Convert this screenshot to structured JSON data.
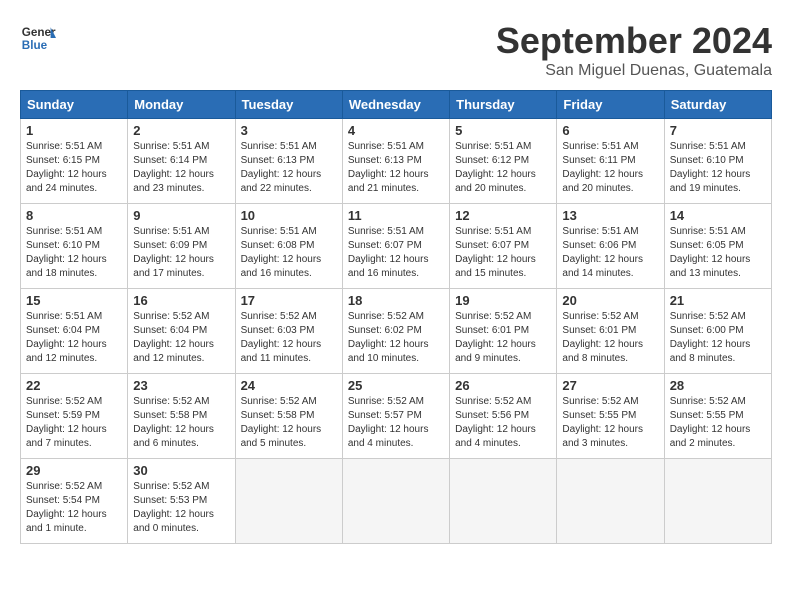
{
  "header": {
    "logo_line1": "General",
    "logo_line2": "Blue",
    "month": "September 2024",
    "location": "San Miguel Duenas, Guatemala"
  },
  "days_of_week": [
    "Sunday",
    "Monday",
    "Tuesday",
    "Wednesday",
    "Thursday",
    "Friday",
    "Saturday"
  ],
  "weeks": [
    [
      {
        "day": 1,
        "sunrise": "5:51 AM",
        "sunset": "6:15 PM",
        "daylight": "12 hours and 24 minutes."
      },
      {
        "day": 2,
        "sunrise": "5:51 AM",
        "sunset": "6:14 PM",
        "daylight": "12 hours and 23 minutes."
      },
      {
        "day": 3,
        "sunrise": "5:51 AM",
        "sunset": "6:13 PM",
        "daylight": "12 hours and 22 minutes."
      },
      {
        "day": 4,
        "sunrise": "5:51 AM",
        "sunset": "6:13 PM",
        "daylight": "12 hours and 21 minutes."
      },
      {
        "day": 5,
        "sunrise": "5:51 AM",
        "sunset": "6:12 PM",
        "daylight": "12 hours and 20 minutes."
      },
      {
        "day": 6,
        "sunrise": "5:51 AM",
        "sunset": "6:11 PM",
        "daylight": "12 hours and 20 minutes."
      },
      {
        "day": 7,
        "sunrise": "5:51 AM",
        "sunset": "6:10 PM",
        "daylight": "12 hours and 19 minutes."
      }
    ],
    [
      {
        "day": 8,
        "sunrise": "5:51 AM",
        "sunset": "6:10 PM",
        "daylight": "12 hours and 18 minutes."
      },
      {
        "day": 9,
        "sunrise": "5:51 AM",
        "sunset": "6:09 PM",
        "daylight": "12 hours and 17 minutes."
      },
      {
        "day": 10,
        "sunrise": "5:51 AM",
        "sunset": "6:08 PM",
        "daylight": "12 hours and 16 minutes."
      },
      {
        "day": 11,
        "sunrise": "5:51 AM",
        "sunset": "6:07 PM",
        "daylight": "12 hours and 16 minutes."
      },
      {
        "day": 12,
        "sunrise": "5:51 AM",
        "sunset": "6:07 PM",
        "daylight": "12 hours and 15 minutes."
      },
      {
        "day": 13,
        "sunrise": "5:51 AM",
        "sunset": "6:06 PM",
        "daylight": "12 hours and 14 minutes."
      },
      {
        "day": 14,
        "sunrise": "5:51 AM",
        "sunset": "6:05 PM",
        "daylight": "12 hours and 13 minutes."
      }
    ],
    [
      {
        "day": 15,
        "sunrise": "5:51 AM",
        "sunset": "6:04 PM",
        "daylight": "12 hours and 12 minutes."
      },
      {
        "day": 16,
        "sunrise": "5:52 AM",
        "sunset": "6:04 PM",
        "daylight": "12 hours and 12 minutes."
      },
      {
        "day": 17,
        "sunrise": "5:52 AM",
        "sunset": "6:03 PM",
        "daylight": "12 hours and 11 minutes."
      },
      {
        "day": 18,
        "sunrise": "5:52 AM",
        "sunset": "6:02 PM",
        "daylight": "12 hours and 10 minutes."
      },
      {
        "day": 19,
        "sunrise": "5:52 AM",
        "sunset": "6:01 PM",
        "daylight": "12 hours and 9 minutes."
      },
      {
        "day": 20,
        "sunrise": "5:52 AM",
        "sunset": "6:01 PM",
        "daylight": "12 hours and 8 minutes."
      },
      {
        "day": 21,
        "sunrise": "5:52 AM",
        "sunset": "6:00 PM",
        "daylight": "12 hours and 8 minutes."
      }
    ],
    [
      {
        "day": 22,
        "sunrise": "5:52 AM",
        "sunset": "5:59 PM",
        "daylight": "12 hours and 7 minutes."
      },
      {
        "day": 23,
        "sunrise": "5:52 AM",
        "sunset": "5:58 PM",
        "daylight": "12 hours and 6 minutes."
      },
      {
        "day": 24,
        "sunrise": "5:52 AM",
        "sunset": "5:58 PM",
        "daylight": "12 hours and 5 minutes."
      },
      {
        "day": 25,
        "sunrise": "5:52 AM",
        "sunset": "5:57 PM",
        "daylight": "12 hours and 4 minutes."
      },
      {
        "day": 26,
        "sunrise": "5:52 AM",
        "sunset": "5:56 PM",
        "daylight": "12 hours and 4 minutes."
      },
      {
        "day": 27,
        "sunrise": "5:52 AM",
        "sunset": "5:55 PM",
        "daylight": "12 hours and 3 minutes."
      },
      {
        "day": 28,
        "sunrise": "5:52 AM",
        "sunset": "5:55 PM",
        "daylight": "12 hours and 2 minutes."
      }
    ],
    [
      {
        "day": 29,
        "sunrise": "5:52 AM",
        "sunset": "5:54 PM",
        "daylight": "12 hours and 1 minute."
      },
      {
        "day": 30,
        "sunrise": "5:52 AM",
        "sunset": "5:53 PM",
        "daylight": "12 hours and 0 minutes."
      },
      null,
      null,
      null,
      null,
      null
    ]
  ]
}
